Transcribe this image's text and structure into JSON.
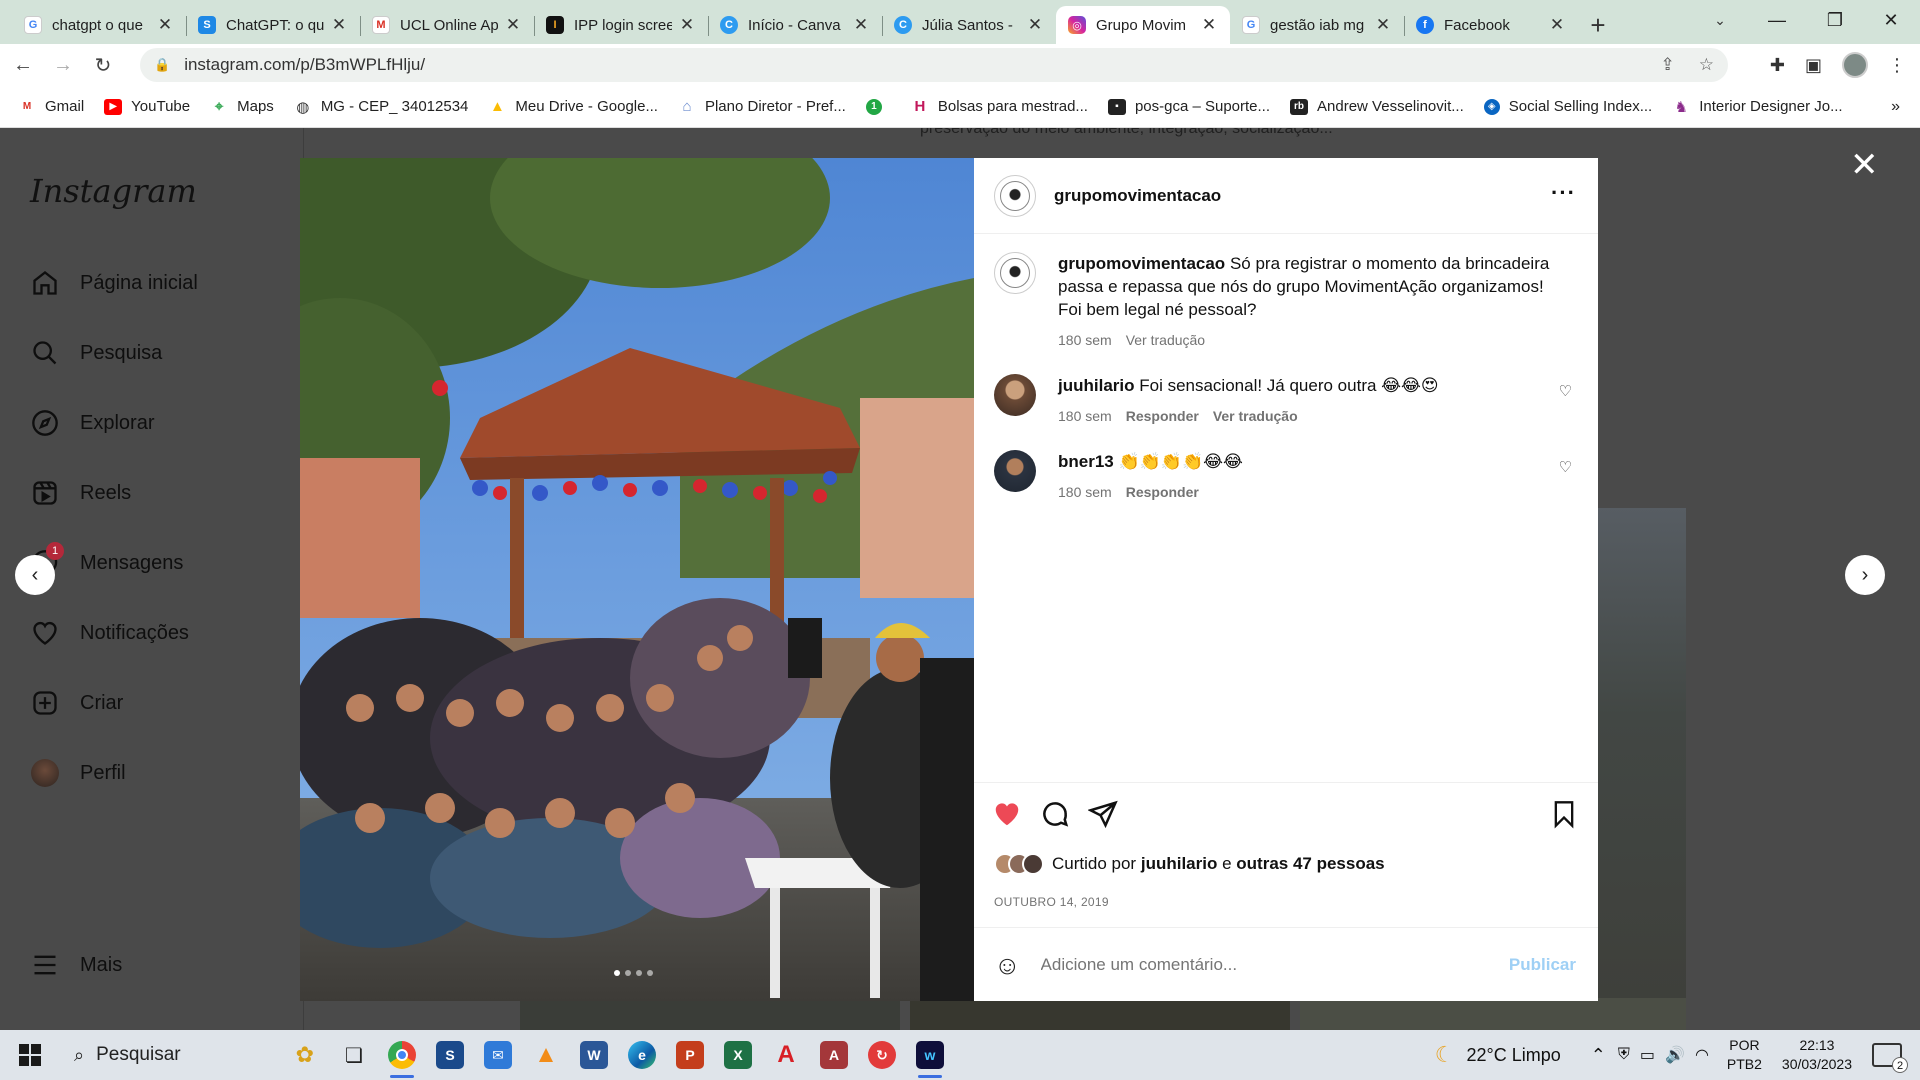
{
  "browser": {
    "tabs": [
      {
        "title": "chatgpt o que",
        "favicon": "google-icon",
        "color": "#4285f4"
      },
      {
        "title": "ChatGPT: o qu",
        "favicon": "s-icon",
        "color": "#1e88e5"
      },
      {
        "title": "UCL Online Ap",
        "favicon": "gmail-icon",
        "color": "#d93025"
      },
      {
        "title": "IPP login scree",
        "favicon": "ipp-icon",
        "color": "#111111"
      },
      {
        "title": "Início - Canva",
        "favicon": "canva-icon",
        "color": "#2d9bf0"
      },
      {
        "title": "Júlia Santos - ",
        "favicon": "canva-icon",
        "color": "#2d9bf0"
      },
      {
        "title": "Grupo Movim",
        "favicon": "instagram-icon",
        "color": "#d6249f"
      },
      {
        "title": "gestão iab mg",
        "favicon": "google-icon",
        "color": "#4285f4"
      },
      {
        "title": "Facebook",
        "favicon": "facebook-icon",
        "color": "#1877f2"
      }
    ],
    "active_tab_index": 6,
    "url": "instagram.com/p/B3mWPLfHlju/",
    "bookmarks": [
      {
        "label": "Gmail",
        "icon": "gmail-icon",
        "color": "#d93025"
      },
      {
        "label": "YouTube",
        "icon": "youtube-icon",
        "color": "#ff0000"
      },
      {
        "label": "Maps",
        "icon": "maps-icon",
        "color": "#34a853"
      },
      {
        "label": "MG - CEP_ 34012534",
        "icon": "globe-icon",
        "color": "#333333"
      },
      {
        "label": "Meu Drive - Google...",
        "icon": "drive-icon",
        "color": "#fbbc04"
      },
      {
        "label": "Plano Diretor - Pref...",
        "icon": "city-icon",
        "color": "#6b8ccf"
      },
      {
        "label": "",
        "icon": "circle-1-icon",
        "color": "#22a745"
      },
      {
        "label": "Bolsas para mestrad...",
        "icon": "h-icon",
        "color": "#c2185b"
      },
      {
        "label": "pos-gca – Suporte...",
        "icon": "person-card-icon",
        "color": "#222222"
      },
      {
        "label": "Andrew Vesselinovit...",
        "icon": "rb-icon",
        "color": "#222222"
      },
      {
        "label": "Social Selling Index...",
        "icon": "compass-icon",
        "color": "#0a66c2"
      },
      {
        "label": "Interior Designer Jo...",
        "icon": "figure-icon",
        "color": "#8b2b8b"
      }
    ]
  },
  "instagram": {
    "logo": "Instagram",
    "nav": [
      {
        "label": "Página inicial",
        "icon": "home-icon"
      },
      {
        "label": "Pesquisa",
        "icon": "search-icon"
      },
      {
        "label": "Explorar",
        "icon": "compass-icon"
      },
      {
        "label": "Reels",
        "icon": "reels-icon"
      },
      {
        "label": "Mensagens",
        "icon": "messenger-icon",
        "badge": "1"
      },
      {
        "label": "Notificações",
        "icon": "heart-icon"
      },
      {
        "label": "Criar",
        "icon": "plus-square-icon"
      },
      {
        "label": "Perfil",
        "icon": "avatar-icon"
      }
    ],
    "more_label": "Mais",
    "bg_text": "preservação do meio ambiente, integração, socialização...",
    "post": {
      "username": "grupomovimentacao",
      "caption_user": "grupomovimentacao",
      "caption_text": "Só pra registrar o momento da brincadeira passa e repassa que nós do grupo MovimentAção organizamos! Foi bem legal né pessoal?",
      "caption_time": "180 sem",
      "caption_translate": "Ver tradução",
      "comments": [
        {
          "user": "juuhilario",
          "text": "Foi sensacional! Já quero outra 😂😂😍",
          "time": "180 sem",
          "reply": "Responder",
          "translate": "Ver tradução"
        },
        {
          "user": "bner13",
          "text": "👏👏👏👏😂😂",
          "time": "180 sem",
          "reply": "Responder"
        }
      ],
      "liked_prefix": "Curtido por",
      "liked_user": "juuhilario",
      "liked_joiner": "e",
      "liked_others": "outras 47 pessoas",
      "date": "OUTUBRO 14, 2019",
      "comment_placeholder": "Adicione um comentário...",
      "publish_label": "Publicar",
      "carousel_count": 4,
      "carousel_index": 0,
      "liked": true
    }
  },
  "taskbar": {
    "search_label": "Pesquisar",
    "weather": "22°C  Limpo",
    "lang_top": "POR",
    "lang_bottom": "PTB2",
    "time": "22:13",
    "date": "30/03/2023",
    "notification_count": "2",
    "apps": [
      "task-view-icon",
      "chrome-icon",
      "sketchup-icon",
      "mail-icon",
      "vlc-icon",
      "word-icon",
      "edge-icon",
      "powerpoint-icon",
      "excel-icon",
      "acrobat-icon",
      "access-icon",
      "refresh-app-icon",
      "webex-icon"
    ]
  }
}
